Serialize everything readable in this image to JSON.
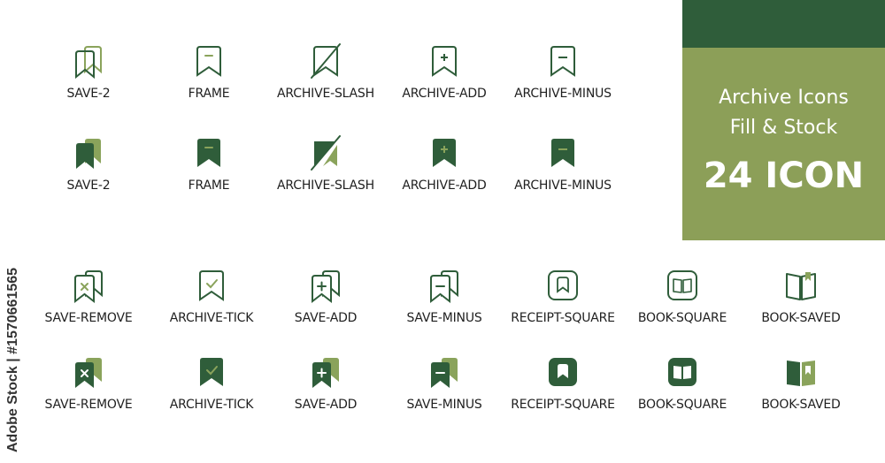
{
  "colors": {
    "dark_green": "#2f5d3a",
    "light_green": "#8aa35b",
    "promo_dark": "#2f5d3a",
    "promo_light": "#8c9f58",
    "text": "#1f1f1f"
  },
  "promo": {
    "title": "Archive Icons",
    "subtitle": "Fill & Stock",
    "count": "24 ICON"
  },
  "credit": "Adobe Stock | #1570661565",
  "rows": [
    {
      "style": "outline",
      "items": [
        {
          "icon": "save-2",
          "label": "SAVE-2"
        },
        {
          "icon": "frame",
          "label": "FRAME"
        },
        {
          "icon": "archive-slash",
          "label": "ARCHIVE-SLASH"
        },
        {
          "icon": "archive-add",
          "label": "ARCHIVE-ADD"
        },
        {
          "icon": "archive-minus",
          "label": "ARCHIVE-MINUS"
        }
      ]
    },
    {
      "style": "fill",
      "items": [
        {
          "icon": "save-2",
          "label": "SAVE-2"
        },
        {
          "icon": "frame",
          "label": "FRAME"
        },
        {
          "icon": "archive-slash",
          "label": "ARCHIVE-SLASH"
        },
        {
          "icon": "archive-add",
          "label": "ARCHIVE-ADD"
        },
        {
          "icon": "archive-minus",
          "label": "ARCHIVE-MINUS"
        }
      ]
    },
    {
      "style": "outline",
      "items": [
        {
          "icon": "save-remove",
          "label": "SAVE-REMOVE"
        },
        {
          "icon": "archive-tick",
          "label": "ARCHIVE-TICK"
        },
        {
          "icon": "save-add",
          "label": "SAVE-ADD"
        },
        {
          "icon": "save-minus",
          "label": "SAVE-MINUS"
        },
        {
          "icon": "receipt-square",
          "label": "RECEIPT-SQUARE"
        },
        {
          "icon": "book-square",
          "label": "BOOK-SQUARE"
        },
        {
          "icon": "book-saved",
          "label": "BOOK-SAVED"
        }
      ]
    },
    {
      "style": "fill",
      "items": [
        {
          "icon": "save-remove",
          "label": "SAVE-REMOVE"
        },
        {
          "icon": "archive-tick",
          "label": "ARCHIVE-TICK"
        },
        {
          "icon": "save-add",
          "label": "SAVE-ADD"
        },
        {
          "icon": "save-minus",
          "label": "SAVE-MINUS"
        },
        {
          "icon": "receipt-square",
          "label": "RECEIPT-SQUARE"
        },
        {
          "icon": "book-square",
          "label": "BOOK-SQUARE"
        },
        {
          "icon": "book-saved",
          "label": "BOOK-SAVED"
        }
      ]
    }
  ]
}
